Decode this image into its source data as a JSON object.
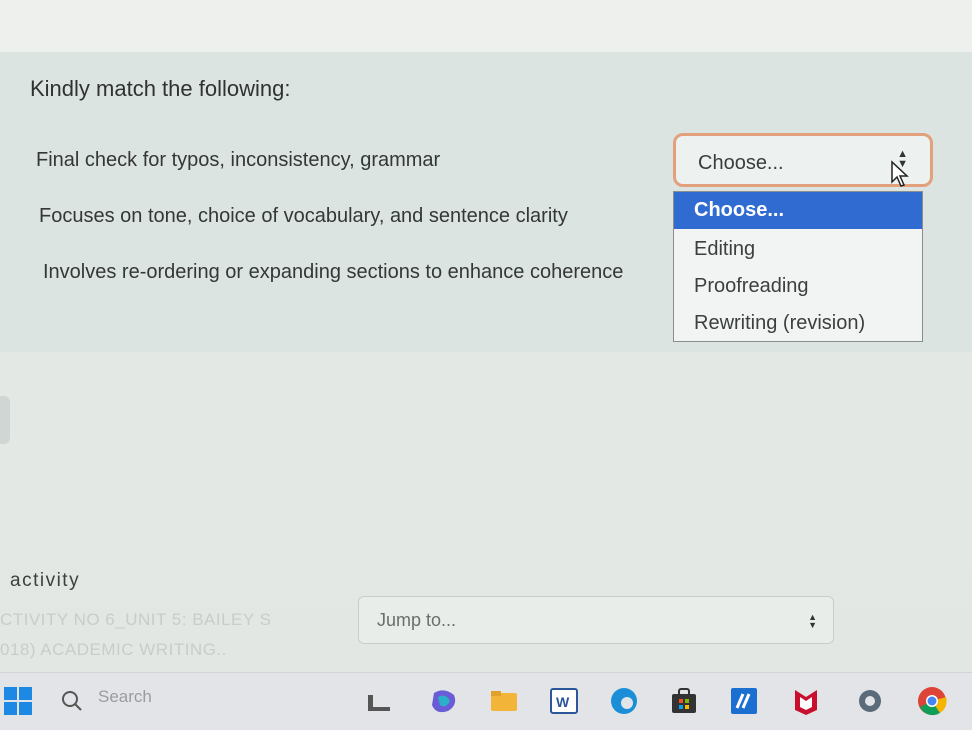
{
  "question": {
    "title": "Kindly match the following:",
    "rows": [
      "Final check for typos, inconsistency, grammar",
      "Focuses on tone, choice of vocabulary, and sentence clarity",
      "Involves re-ordering or expanding sections to enhance coherence"
    ],
    "select_value": "Choose...",
    "options": [
      "Choose...",
      "Editing",
      "Proofreading",
      "Rewriting (revision)"
    ]
  },
  "activity": {
    "label": "activity",
    "prev_link_line1": "CTIVITY NO 6_UNIT 5: BAILEY S",
    "prev_link_line2": "018) ACADEMIC WRITING..",
    "jump_placeholder": "Jump to..."
  },
  "taskbar": {
    "search_label": "Search",
    "icons": [
      "windows-start-icon",
      "search-icon",
      "widgets-icon",
      "copilot-icon",
      "file-explorer-icon",
      "word-icon",
      "edge-icon",
      "store-icon",
      "app-icon",
      "mcafee-icon",
      "settings-icon",
      "chrome-icon"
    ]
  },
  "colors": {
    "focus_border": "#e3a07c",
    "option_selected": "#2f6bd0"
  }
}
